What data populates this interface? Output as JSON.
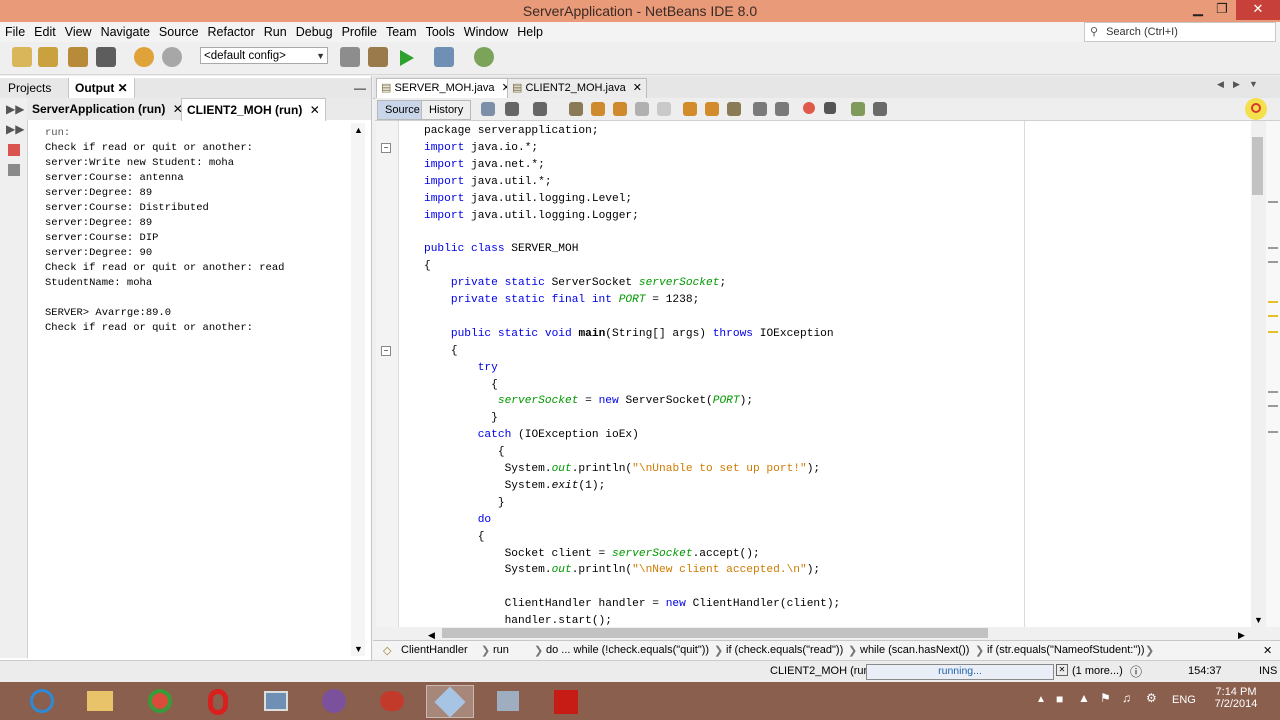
{
  "window": {
    "title": "ServerApplication - NetBeans IDE 8.0",
    "minimize": "▁",
    "maximize": "❐",
    "close": "✕"
  },
  "menu": [
    "File",
    "Edit",
    "View",
    "Navigate",
    "Source",
    "Refactor",
    "Run",
    "Debug",
    "Profile",
    "Team",
    "Tools",
    "Window",
    "Help"
  ],
  "search": {
    "placeholder": "Search (Ctrl+I)"
  },
  "toolbar": {
    "config": "<default config>"
  },
  "left_panel": {
    "tabs": [
      "Projects",
      "Output"
    ],
    "subtabs": [
      "ServerApplication (run)",
      "CLIENT2_MOH (run)"
    ],
    "output_lines": [
      "run:",
      "Check if read or quit or another:",
      "server:Write new Student: moha",
      "server:Course: antenna",
      "server:Degree: 89",
      "server:Course: Distributed",
      "server:Degree: 89",
      "server:Course: DIP",
      "server:Degree: 90",
      "Check if read or quit or another: read",
      "StudentName: moha",
      "",
      "SERVER> Avarrge:89.0",
      "Check if read or quit or another:"
    ]
  },
  "editor": {
    "tabs": [
      "SERVER_MOH.java",
      "CLIENT2_MOH.java"
    ],
    "source_label": "Source",
    "history_label": "History",
    "code": [
      [
        {
          "t": "package serverapplication;"
        }
      ],
      [
        {
          "t": "import",
          "c": "kw"
        },
        {
          "t": " java.io.*;"
        }
      ],
      [
        {
          "t": "import",
          "c": "kw"
        },
        {
          "t": " java.net.*;"
        }
      ],
      [
        {
          "t": "import",
          "c": "kw"
        },
        {
          "t": " java.util.*;"
        }
      ],
      [
        {
          "t": "import",
          "c": "kw"
        },
        {
          "t": " java.util.logging.Level;"
        }
      ],
      [
        {
          "t": "import",
          "c": "kw"
        },
        {
          "t": " java.util.logging.Logger;"
        }
      ],
      [
        {
          "t": ""
        }
      ],
      [
        {
          "t": "public class",
          "c": "kw"
        },
        {
          "t": " SERVER_MOH"
        }
      ],
      [
        {
          "t": "{"
        }
      ],
      [
        {
          "t": "    "
        },
        {
          "t": "private static",
          "c": "kw"
        },
        {
          "t": " ServerSocket "
        },
        {
          "t": "serverSocket",
          "c": "fld"
        },
        {
          "t": ";"
        }
      ],
      [
        {
          "t": "    "
        },
        {
          "t": "private static final int",
          "c": "kw"
        },
        {
          "t": " "
        },
        {
          "t": "PORT",
          "c": "fld"
        },
        {
          "t": " = 1238;"
        }
      ],
      [
        {
          "t": ""
        }
      ],
      [
        {
          "t": "    "
        },
        {
          "t": "public static void",
          "c": "kw"
        },
        {
          "t": " "
        },
        {
          "t": "main",
          "c": "mth"
        },
        {
          "t": "(String[] args) "
        },
        {
          "t": "throws",
          "c": "kw"
        },
        {
          "t": " IOException"
        }
      ],
      [
        {
          "t": "    {"
        }
      ],
      [
        {
          "t": "        "
        },
        {
          "t": "try",
          "c": "kw"
        }
      ],
      [
        {
          "t": "          {"
        }
      ],
      [
        {
          "t": "           "
        },
        {
          "t": "serverSocket",
          "c": "fld"
        },
        {
          "t": " = "
        },
        {
          "t": "new",
          "c": "kw"
        },
        {
          "t": " ServerSocket("
        },
        {
          "t": "PORT",
          "c": "fld"
        },
        {
          "t": ");"
        }
      ],
      [
        {
          "t": "          }"
        }
      ],
      [
        {
          "t": "        "
        },
        {
          "t": "catch",
          "c": "kw"
        },
        {
          "t": " (IOException ioEx)"
        }
      ],
      [
        {
          "t": "           {"
        }
      ],
      [
        {
          "t": "            System."
        },
        {
          "t": "out",
          "c": "fld"
        },
        {
          "t": ".println("
        },
        {
          "t": "\"\\nUnable to set up port!\"",
          "c": "str"
        },
        {
          "t": ");"
        }
      ],
      [
        {
          "t": "            System."
        },
        {
          "t": "exit",
          "c": "it"
        },
        {
          "t": "(1);"
        }
      ],
      [
        {
          "t": "           }"
        }
      ],
      [
        {
          "t": "        "
        },
        {
          "t": "do",
          "c": "kw"
        }
      ],
      [
        {
          "t": "        {"
        }
      ],
      [
        {
          "t": "            Socket client = "
        },
        {
          "t": "serverSocket",
          "c": "fld"
        },
        {
          "t": ".accept();"
        }
      ],
      [
        {
          "t": "            System."
        },
        {
          "t": "out",
          "c": "fld"
        },
        {
          "t": ".println("
        },
        {
          "t": "\"\\nNew client accepted.\\n\"",
          "c": "str"
        },
        {
          "t": ");"
        }
      ],
      [
        {
          "t": ""
        }
      ],
      [
        {
          "t": "            ClientHandler handler = "
        },
        {
          "t": "new",
          "c": "kw"
        },
        {
          "t": " ClientHandler(client);"
        }
      ],
      [
        {
          "t": "            handler.start();"
        }
      ]
    ]
  },
  "breadcrumbs": [
    "ClientHandler",
    "run",
    "do ... while (!check.equals(\"quit\"))",
    "if (check.equals(\"read\"))",
    "while (scan.hasNext())",
    "if (str.equals(\"NameofStudent:\"))"
  ],
  "status": {
    "process": "CLIENT2_MOH (run)",
    "running": "running...",
    "more": "(1 more...)",
    "position": "154:37",
    "mode": "INS"
  },
  "taskbar": {
    "lang": "ENG",
    "time": "7:14 PM",
    "date": "7/2/2014"
  }
}
